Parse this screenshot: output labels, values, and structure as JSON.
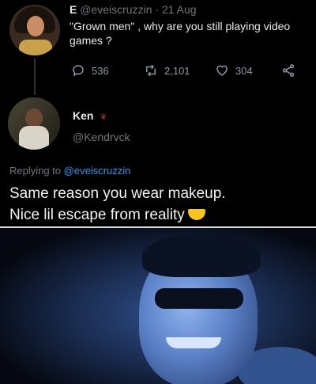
{
  "original_tweet": {
    "author": "E",
    "handle": "@eveiscruzzin",
    "separator": "·",
    "date": "21 Aug",
    "text": "\"Grown men\" , why are you still playing video games ?",
    "actions": {
      "replies": "536",
      "retweets": "2,101",
      "likes": "304"
    }
  },
  "reply": {
    "author": "Ken",
    "handle": "@Kendrvck",
    "replying_prefix": "Replying to",
    "replying_to": "@eveiscruzzin",
    "line1": "Same reason you wear makeup.",
    "line2": "Nice lil escape from reality"
  },
  "colors": {
    "background": "#000000",
    "text_primary": "#e7e9ea",
    "text_secondary": "#71767b",
    "mention": "#1d9bf0"
  },
  "icons": {
    "reply": "reply-icon",
    "retweet": "retweet-icon",
    "like": "heart-icon",
    "share": "share-icon",
    "emoji": "sweat-smile-emoji"
  }
}
